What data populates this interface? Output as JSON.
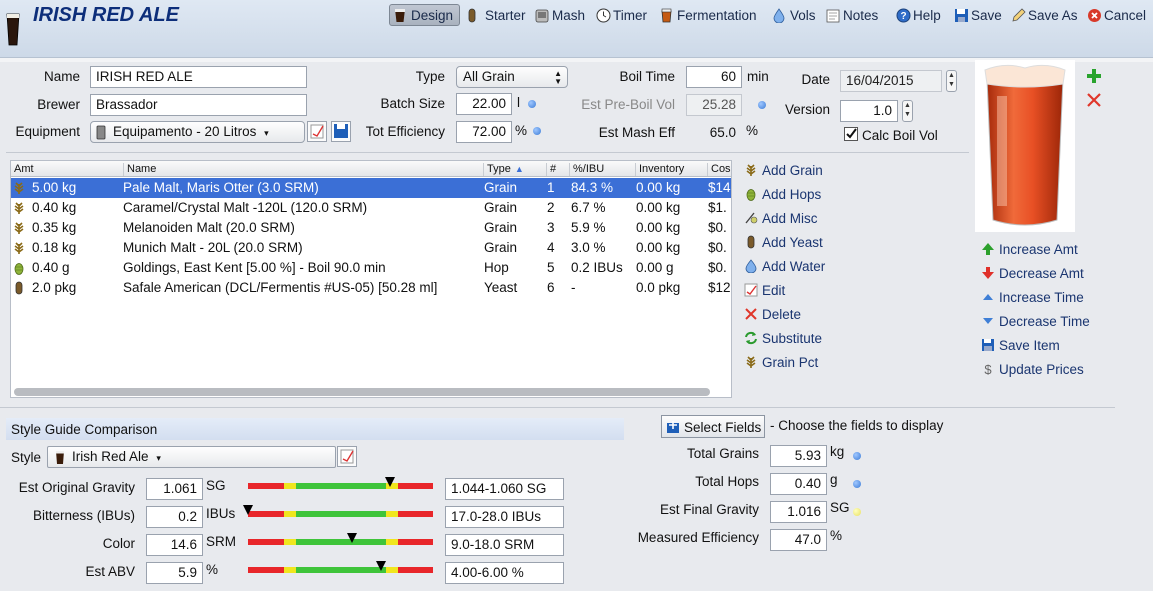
{
  "header": {
    "title": "IRISH RED ALE",
    "toolbar": [
      {
        "label": "Design",
        "icon": "pint-glass-icon"
      },
      {
        "label": "Starter",
        "icon": "yeast-tube-icon"
      },
      {
        "label": "Mash",
        "icon": "mash-tun-icon"
      },
      {
        "label": "Timer",
        "icon": "clock-icon"
      },
      {
        "label": "Fermentation",
        "icon": "fermenter-icon"
      },
      {
        "label": "Vols",
        "icon": "water-drop-icon"
      },
      {
        "label": "Notes",
        "icon": "notes-icon"
      },
      {
        "label": "Help",
        "icon": "help-icon"
      },
      {
        "label": "Save",
        "icon": "save-icon"
      },
      {
        "label": "Save As",
        "icon": "save-as-icon"
      },
      {
        "label": "Cancel",
        "icon": "cancel-icon"
      }
    ]
  },
  "details": {
    "name_label": "Name",
    "name_value": "IRISH RED ALE",
    "brewer_label": "Brewer",
    "brewer_value": "Brassador",
    "equipment_label": "Equipment",
    "equipment_value": "Equipamento - 20 Litros",
    "type_label": "Type",
    "type_value": "All Grain",
    "batch_label": "Batch Size",
    "batch_value": "22.00",
    "batch_unit": "l",
    "eff_label": "Tot Efficiency",
    "eff_value": "72.00",
    "eff_unit": "%",
    "boil_label": "Boil Time",
    "boil_value": "60",
    "boil_unit": "min",
    "preboil_label": "Est Pre-Boil Vol",
    "preboil_value": "25.28",
    "mash_eff_label": "Est Mash Eff",
    "mash_eff_value": "65.0",
    "mash_eff_unit": "%",
    "date_label": "Date",
    "date_value": "16/04/2015",
    "version_label": "Version",
    "version_value": "1.0",
    "calc_boil_label": "Calc Boil Vol",
    "calc_boil_checked": true
  },
  "ingredients": {
    "columns": [
      "Amt",
      "Name",
      "Type",
      "#",
      "%/IBU",
      "Inventory",
      "Cos"
    ],
    "rows": [
      {
        "amt": "5.00 kg",
        "name": "Pale Malt, Maris Otter (3.0 SRM)",
        "type": "Grain",
        "num": "1",
        "pct": "84.3 %",
        "inv": "0.00 kg",
        "cost": "$14",
        "icon": "grain-icon",
        "selected": true
      },
      {
        "amt": "0.40 kg",
        "name": "Caramel/Crystal Malt -120L (120.0 SRM)",
        "type": "Grain",
        "num": "2",
        "pct": "6.7 %",
        "inv": "0.00 kg",
        "cost": "$1.",
        "icon": "grain-icon"
      },
      {
        "amt": "0.35 kg",
        "name": "Melanoiden Malt (20.0 SRM)",
        "type": "Grain",
        "num": "3",
        "pct": "5.9 %",
        "inv": "0.00 kg",
        "cost": "$0.",
        "icon": "grain-icon"
      },
      {
        "amt": "0.18 kg",
        "name": "Munich Malt - 20L (20.0 SRM)",
        "type": "Grain",
        "num": "4",
        "pct": "3.0 %",
        "inv": "0.00 kg",
        "cost": "$0.",
        "icon": "grain-icon"
      },
      {
        "amt": "0.40 g",
        "name": "Goldings, East Kent [5.00 %] - Boil 90.0 min",
        "type": "Hop",
        "num": "5",
        "pct": "0.2 IBUs",
        "inv": "0.00 g",
        "cost": "$0.",
        "icon": "hop-icon"
      },
      {
        "amt": "2.0 pkg",
        "name": "Safale American  (DCL/Fermentis #US-05) [50.28 ml]",
        "type": "Yeast",
        "num": "6",
        "pct": "-",
        "inv": "0.0 pkg",
        "cost": "$12",
        "icon": "yeast-tube-icon"
      }
    ]
  },
  "actions": [
    {
      "label": "Add Grain",
      "icon": "grain-icon"
    },
    {
      "label": "Add Hops",
      "icon": "hop-icon"
    },
    {
      "label": "Add Misc",
      "icon": "misc-icon"
    },
    {
      "label": "Add Yeast",
      "icon": "yeast-tube-icon"
    },
    {
      "label": "Add Water",
      "icon": "water-drop-icon"
    },
    {
      "label": "Edit",
      "icon": "edit-icon"
    },
    {
      "label": "Delete",
      "icon": "delete-icon"
    },
    {
      "label": "Substitute",
      "icon": "substitute-icon"
    },
    {
      "label": "Grain Pct",
      "icon": "grain-icon"
    }
  ],
  "amount_actions": [
    {
      "label": "Increase Amt",
      "icon": "arrow-up-icon"
    },
    {
      "label": "Decrease Amt",
      "icon": "arrow-down-icon"
    },
    {
      "label": "Increase Time",
      "icon": "triangle-up-icon"
    },
    {
      "label": "Decrease Time",
      "icon": "triangle-down-icon"
    },
    {
      "label": "Save Item",
      "icon": "save-icon"
    },
    {
      "label": "Update Prices",
      "icon": "dollar-icon"
    }
  ],
  "style_guide": {
    "title": "Style Guide Comparison",
    "style_label": "Style",
    "style_value": "Irish Red Ale",
    "rows": [
      {
        "label": "Est Original Gravity",
        "value": "1.061",
        "unit": "SG",
        "range": "1.044-1.060 SG",
        "marker": 0.77
      },
      {
        "label": "Bitterness (IBUs)",
        "value": "0.2",
        "unit": "IBUs",
        "range": "17.0-28.0 IBUs",
        "marker": 0.0
      },
      {
        "label": "Color",
        "value": "14.6",
        "unit": "SRM",
        "range": "9.0-18.0 SRM",
        "marker": 0.56
      },
      {
        "label": "Est ABV",
        "value": "5.9",
        "unit": "%",
        "range": "4.00-6.00 %",
        "marker": 0.72
      }
    ]
  },
  "summary": {
    "select_fields_label": "Select Fields",
    "select_fields_hint": "- Choose the fields to display",
    "items": [
      {
        "label": "Total Grains",
        "value": "5.93",
        "unit": "kg",
        "dot": "blue"
      },
      {
        "label": "Total Hops",
        "value": "0.40",
        "unit": "g",
        "dot": "blue"
      },
      {
        "label": "Est Final Gravity",
        "value": "1.016",
        "unit": "SG",
        "dot": "yellow"
      },
      {
        "label": "Measured Efficiency",
        "value": "47.0",
        "unit": "%",
        "dot": ""
      }
    ]
  },
  "colors": {
    "accent": "#3b6fd6",
    "title": "#0d2e7a",
    "beer": "#d8421a"
  }
}
